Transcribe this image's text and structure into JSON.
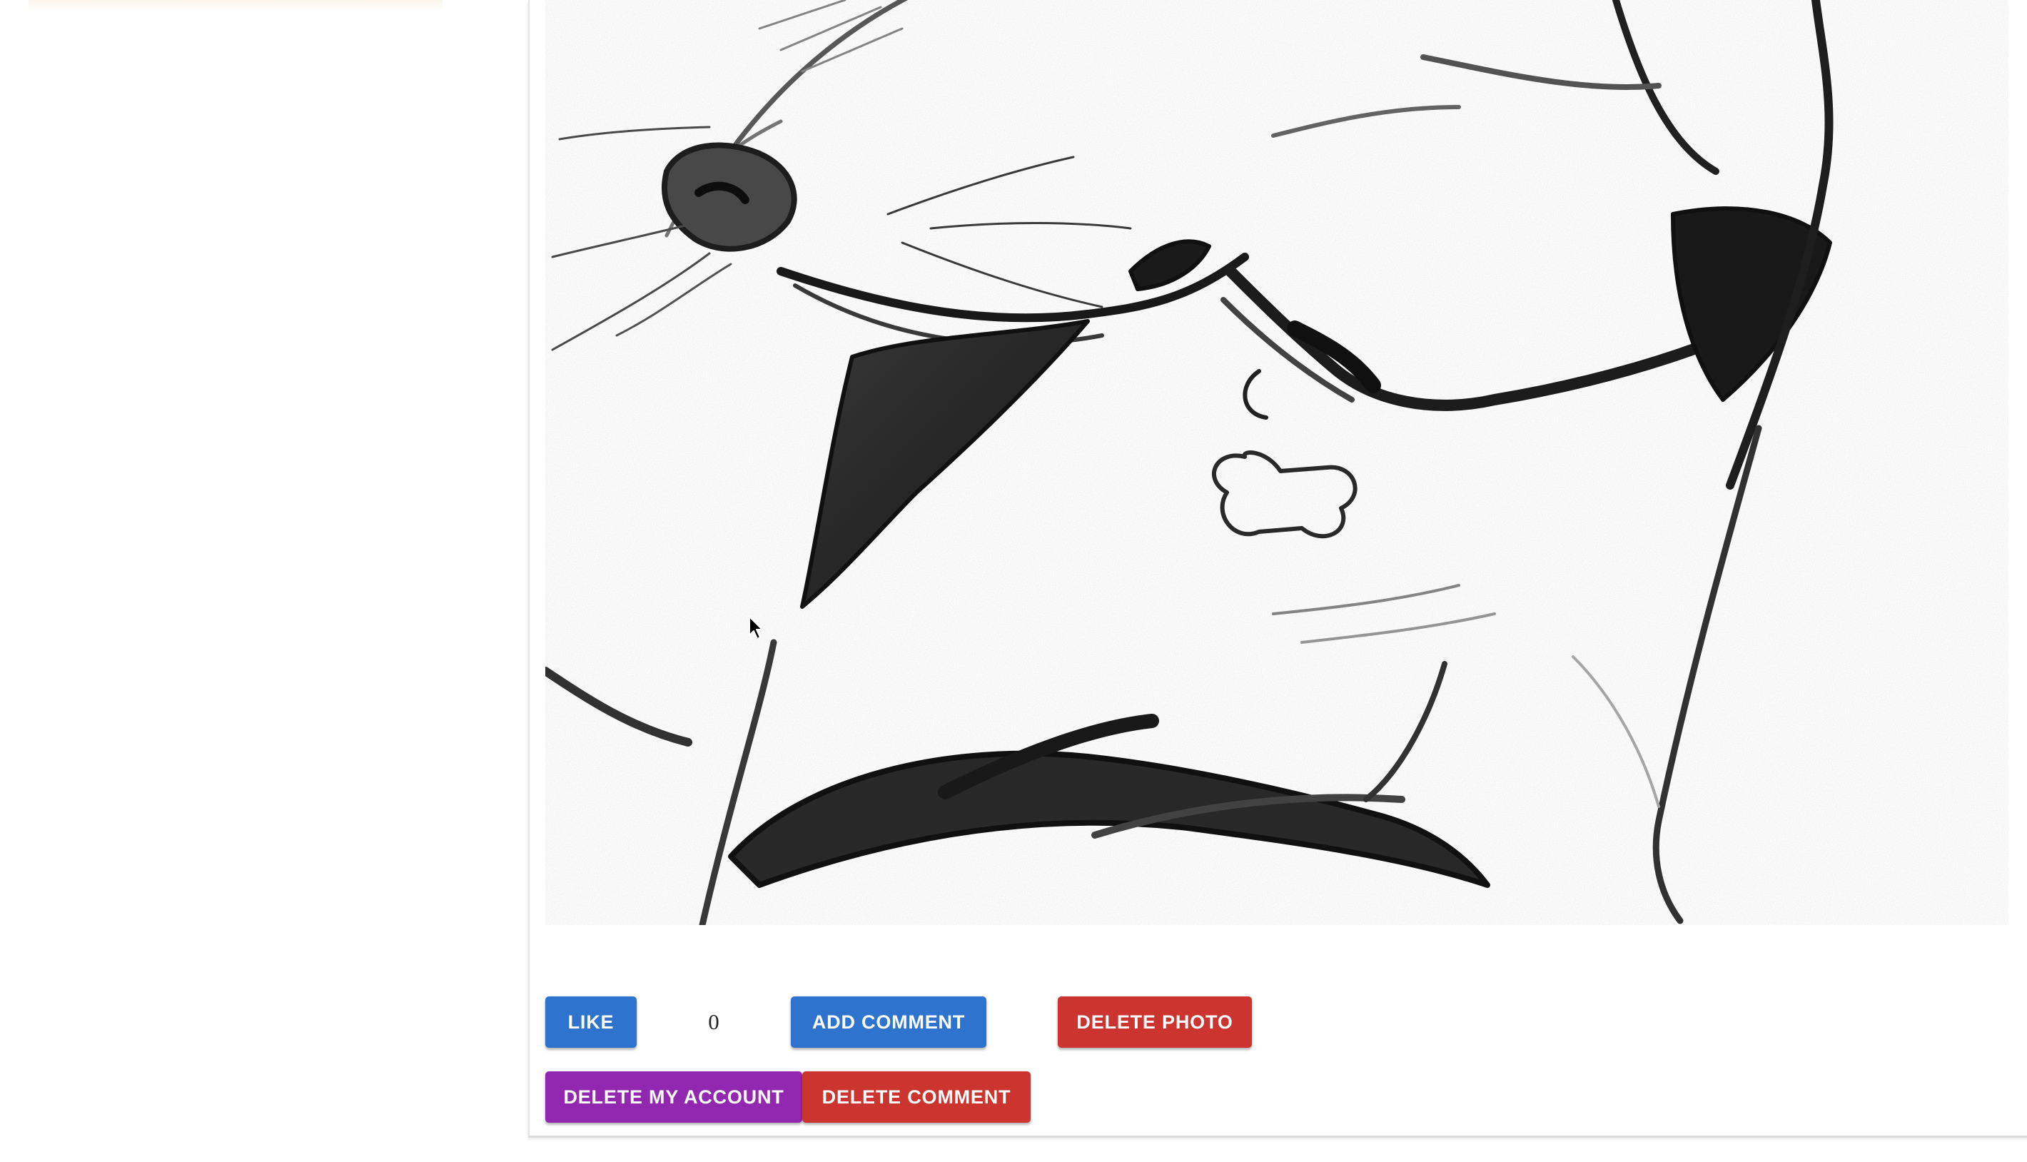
{
  "photo": {
    "subject": "pencil sketch of a dog with a bone-shaped collar tag"
  },
  "actions": {
    "like_label": "Like",
    "like_count": "0",
    "add_comment_label": "Add Comment",
    "delete_photo_label": "Delete Photo",
    "delete_account_label": "Delete My Account",
    "delete_comment_label": "Delete Comment"
  },
  "colors": {
    "primary_blue": "#2e74cf",
    "danger_red": "#cc342f",
    "account_purple": "#9328b0"
  }
}
